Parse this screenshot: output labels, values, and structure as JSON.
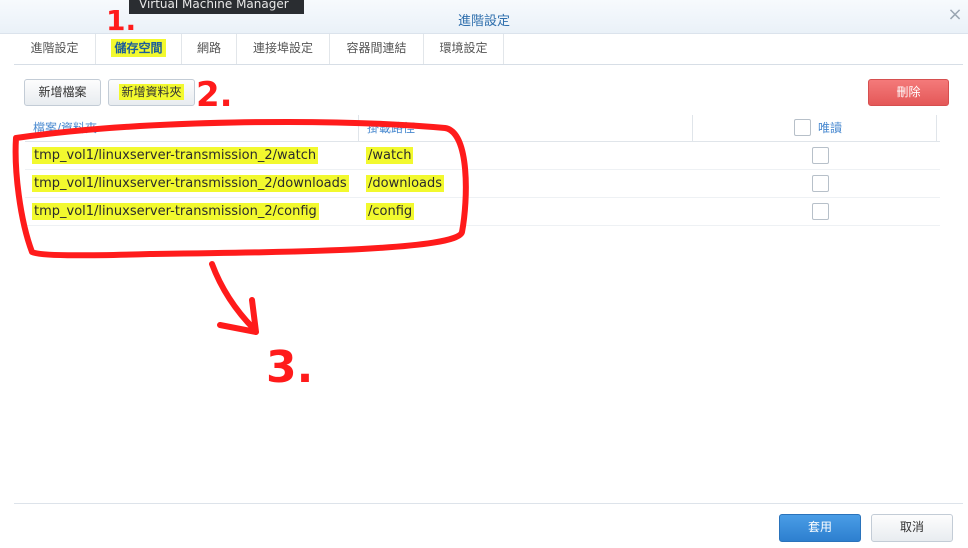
{
  "window": {
    "title": "進階設定",
    "tooltip": "Virtual Machine Manager"
  },
  "tabs": [
    {
      "label": "進階設定"
    },
    {
      "label": "儲存空間"
    },
    {
      "label": "網路"
    },
    {
      "label": "連接埠設定"
    },
    {
      "label": "容器間連結"
    },
    {
      "label": "環境設定"
    }
  ],
  "active_tab": "儲存空間",
  "toolbar": {
    "add_file": "新增檔案",
    "add_folder": "新增資料夾",
    "delete": "刪除"
  },
  "table": {
    "columns": {
      "file_folder": "檔案/資料夾",
      "mount_path": "掛載路徑",
      "read_only": "唯讀"
    },
    "rows": [
      {
        "file_folder": "tmp_vol1/linuxserver-transmission_2/watch",
        "mount_path": "/watch",
        "read_only": false
      },
      {
        "file_folder": "tmp_vol1/linuxserver-transmission_2/downloads",
        "mount_path": "/downloads",
        "read_only": false
      },
      {
        "file_folder": "tmp_vol1/linuxserver-transmission_2/config",
        "mount_path": "/config",
        "read_only": false
      }
    ]
  },
  "footer": {
    "apply": "套用",
    "cancel": "取消"
  },
  "annotations": {
    "step1": "1.",
    "step2": "2.",
    "step3": "3."
  },
  "colors": {
    "highlight": "#f2f92e",
    "annotation": "#ff1b1b",
    "accent": "#2f6fad",
    "danger": "#ec6666",
    "primary": "#3a8cdb"
  }
}
